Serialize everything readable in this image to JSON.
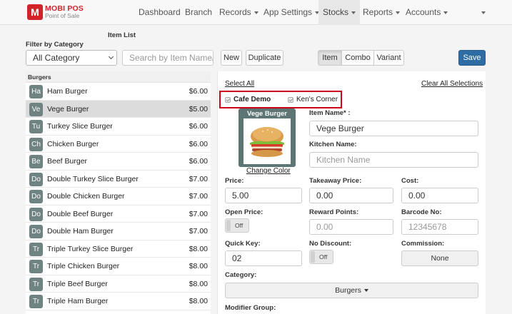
{
  "app": {
    "logo_letter": "M",
    "name": "MOBI POS",
    "tagline": "Point of Sale"
  },
  "nav": {
    "dashboard": "Dashboard",
    "branch": "Branch",
    "records": "Records",
    "app_settings": "App Settings",
    "stocks": "Stocks",
    "reports": "Reports",
    "accounts": "Accounts"
  },
  "toolbar": {
    "item_list_title": "Item List",
    "filter_label": "Filter by Category",
    "category_select_value": "All Category",
    "search_placeholder": "Search by Item Name/B",
    "new_label": "New",
    "duplicate_label": "Duplicate",
    "type_tabs": [
      "Item",
      "Combo",
      "Variant"
    ],
    "active_type": "Item",
    "save_label": "Save"
  },
  "list": {
    "category_header": "Burgers",
    "selected_index": 1,
    "items": [
      {
        "abbr": "Ha",
        "name": "Ham Burger",
        "price": "$6.00"
      },
      {
        "abbr": "Ve",
        "name": "Vege Burger",
        "price": "$5.00"
      },
      {
        "abbr": "Tu",
        "name": "Turkey Slice Burger",
        "price": "$6.00"
      },
      {
        "abbr": "Ch",
        "name": "Chicken Burger",
        "price": "$6.00"
      },
      {
        "abbr": "Be",
        "name": "Beef Burger",
        "price": "$6.00"
      },
      {
        "abbr": "Do",
        "name": "Double Turkey Slice Burger",
        "price": "$7.00"
      },
      {
        "abbr": "Do",
        "name": "Double Chicken Burger",
        "price": "$7.00"
      },
      {
        "abbr": "Do",
        "name": "Double Beef Burger",
        "price": "$7.00"
      },
      {
        "abbr": "Do",
        "name": "Double Ham Burger",
        "price": "$7.00"
      },
      {
        "abbr": "Tr",
        "name": "Triple Turkey Slice Burger",
        "price": "$8.00"
      },
      {
        "abbr": "Tr",
        "name": "Triple Chicken Burger",
        "price": "$8.00"
      },
      {
        "abbr": "Tr",
        "name": "Triple Beef Burger",
        "price": "$8.00"
      },
      {
        "abbr": "Tr",
        "name": "Triple Ham Burger",
        "price": "$8.00"
      },
      {
        "abbr": "",
        "name": "",
        "price": ""
      }
    ]
  },
  "form": {
    "select_all": "Select All",
    "clear_all": "Clear All Selections",
    "sites": [
      {
        "name": "Cafe Demo",
        "checked": true
      },
      {
        "name": "Ken's Corner",
        "checked": true
      }
    ],
    "tile_title": "Vege Burger",
    "change_color": "Change Color",
    "item_name_label": "Item Name* :",
    "item_name_value": "Vege Burger",
    "kitchen_name_label": "Kitchen Name:",
    "kitchen_name_placeholder": "Kitchen Name",
    "price_label": "Price:",
    "price_value": "5.00",
    "takeaway_label": "Takeaway Price:",
    "takeaway_value": "0.00",
    "cost_label": "Cost:",
    "cost_value": "0.00",
    "open_price_label": "Open Price:",
    "open_price_state": "Off",
    "reward_label": "Reward Points:",
    "reward_placeholder": "0.00",
    "barcode_label": "Barcode No:",
    "barcode_placeholder": "12345678",
    "quick_key_label": "Quick Key:",
    "quick_key_value": "02",
    "no_discount_label": "No Discount:",
    "no_discount_state": "Off",
    "commission_label": "Commission:",
    "commission_value": "None",
    "category_label": "Category:",
    "category_value": "Burgers",
    "modifier_group_label": "Modifier Group:"
  },
  "colors": {
    "brand_red": "#d2232a",
    "save_blue": "#2e6da4",
    "badge_gray": "#6f8382",
    "highlight_red": "#d0021b"
  }
}
